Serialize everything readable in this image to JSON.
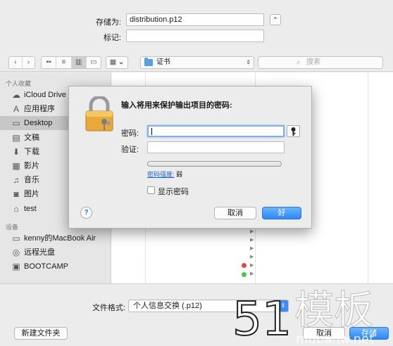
{
  "save_panel": {
    "save_as_label": "存储为:",
    "save_as_value": "distribution.p12",
    "tags_label": "标记:",
    "tags_value": "",
    "collapse_glyph": "⌃"
  },
  "toolbar": {
    "back_glyph": "‹",
    "forward_glyph": "›",
    "view_icons": [
      "icon-view",
      "list-view",
      "column-view",
      "coverflow-view"
    ],
    "arrange_glyph": "⌄",
    "location": "证书",
    "search_placeholder": "搜索"
  },
  "sidebar": {
    "favorites_header": "个人收藏",
    "favorites": [
      {
        "label": "iCloud Drive",
        "icon": "cloud-icon",
        "glyph": "☁"
      },
      {
        "label": "应用程序",
        "icon": "applications-icon",
        "glyph": "A"
      },
      {
        "label": "Desktop",
        "icon": "desktop-icon",
        "glyph": "▭",
        "selected": true
      },
      {
        "label": "文稿",
        "icon": "documents-icon",
        "glyph": "▤"
      },
      {
        "label": "下载",
        "icon": "downloads-icon",
        "glyph": "⬇"
      },
      {
        "label": "影片",
        "icon": "movies-icon",
        "glyph": "▦"
      },
      {
        "label": "音乐",
        "icon": "music-icon",
        "glyph": "♫"
      },
      {
        "label": "图片",
        "icon": "pictures-icon",
        "glyph": "◙"
      },
      {
        "label": "test",
        "icon": "home-icon",
        "glyph": "⌂"
      }
    ],
    "devices_header": "设备",
    "devices": [
      {
        "label": "kenny的MacBook Air",
        "icon": "laptop-icon",
        "glyph": "▭"
      },
      {
        "label": "远程光盘",
        "icon": "disc-icon",
        "glyph": "◎"
      },
      {
        "label": "BOOTCAMP",
        "icon": "drive-icon",
        "glyph": "▣"
      }
    ]
  },
  "browser": {
    "row_arrow": "▶",
    "tag_colors": [
      "#e64545",
      "#4cc24c"
    ]
  },
  "bottom": {
    "format_label": "文件格式:",
    "format_value": "个人信息交换 (.p12)",
    "new_folder": "新建文件夹",
    "cancel_partial": "取消",
    "save_partial": "存储"
  },
  "dialog": {
    "title": "输入将用来保护输出项目的密码:",
    "password_label": "密码:",
    "password_value": "",
    "verify_label": "验证:",
    "verify_value": "",
    "strength_label": "密码强度:",
    "strength_value": "弱",
    "strength_level": 0,
    "show_password_label": "显示密码",
    "help_glyph": "?",
    "cancel": "取消",
    "ok": "好"
  },
  "colors": {
    "accent_blue": "#2d87f5",
    "selection_gray": "#c7c7c7",
    "strength_weak": "#cc3b3b"
  },
  "watermark": {
    "text_number": "51",
    "text_chars": "模板",
    "text_url": "mubanw.net"
  }
}
